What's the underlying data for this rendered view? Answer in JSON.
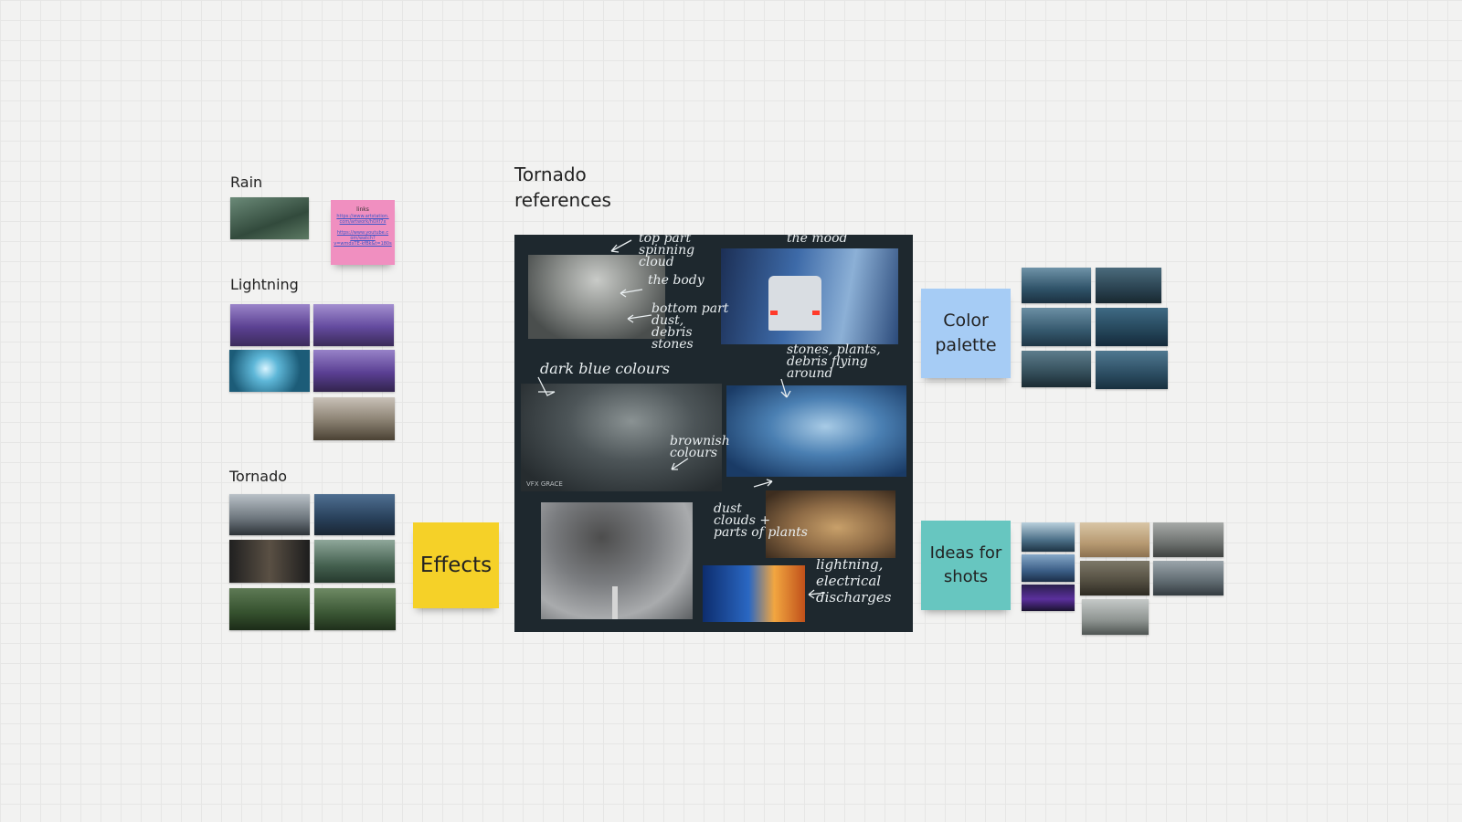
{
  "labels": {
    "rain": "Rain",
    "lightning": "Lightning",
    "tornado": "Tornado",
    "tornado_refs_line1": "Tornado",
    "tornado_refs_line2": "references"
  },
  "stickies": {
    "effects": "Effects",
    "color_palette_line1": "Color",
    "color_palette_line2": "palette",
    "ideas_line1": "Ideas for",
    "ideas_line2": "shots",
    "links": {
      "heading": "links",
      "lines": [
        "https://www.artstation.",
        "com/artwork/h0Xf7x",
        "https://www.youtube.c",
        "om/watch?",
        "v=wmdxTE-kfBk&t=180s"
      ]
    }
  },
  "board_notes": {
    "top_part": "top part\nspinning\ncloud",
    "the_mood": "the mood",
    "the_body": "the body",
    "bottom_part": "bottom part\ndust,\ndebris\nstones",
    "stones_plants": "stones, plants,\ndebris flying\naround",
    "dark_blue": "dark blue colours",
    "brownish": "brownish\ncolours",
    "dust_clouds": "dust\nclouds +\nparts of plants",
    "lightning_discharges": "lightning,\nelectrical\ndischarges",
    "watermark": "VFX GRACE"
  },
  "colors": {
    "canvas": "#f2f2f1",
    "effects_sticky": "#f5d128",
    "color_palette_sticky": "#a6ccf5",
    "ideas_sticky": "#67c6c0",
    "links_sticky": "#f08fc0",
    "board_bg": "#1e282e"
  },
  "icons": {
    "arrow": "hand-drawn-arrow"
  }
}
